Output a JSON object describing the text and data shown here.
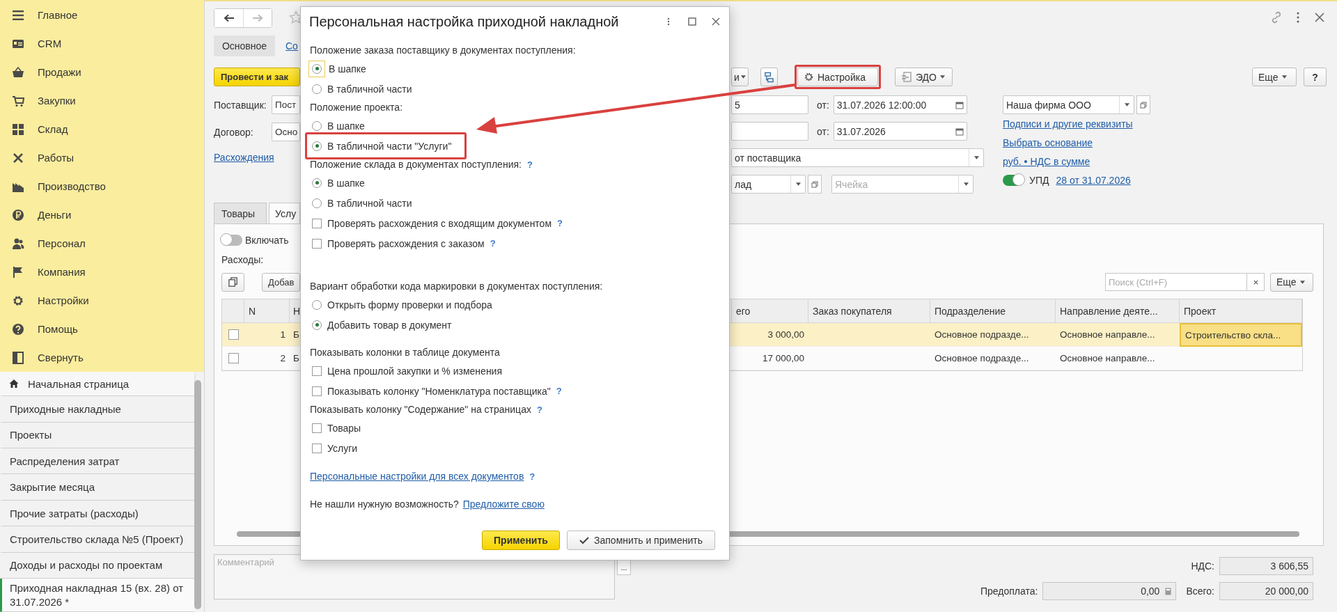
{
  "sidebar": {
    "menu": [
      {
        "label": "Главное"
      },
      {
        "label": "CRM"
      },
      {
        "label": "Продажи"
      },
      {
        "label": "Закупки"
      },
      {
        "label": "Склад"
      },
      {
        "label": "Работы"
      },
      {
        "label": "Производство"
      },
      {
        "label": "Деньги"
      },
      {
        "label": "Персонал"
      },
      {
        "label": "Компания"
      },
      {
        "label": "Настройки"
      },
      {
        "label": "Помощь"
      },
      {
        "label": "Свернуть"
      }
    ],
    "open_windows": [
      {
        "kind": "home",
        "label": "Начальная страница",
        "selected": false
      },
      {
        "kind": "window",
        "label": "Приходные накладные",
        "selected": false
      },
      {
        "kind": "window",
        "label": "Проекты",
        "selected": false
      },
      {
        "kind": "window",
        "label": "Распределения затрат",
        "selected": false
      },
      {
        "kind": "window",
        "label": "Закрытие месяца",
        "selected": false
      },
      {
        "kind": "window",
        "label": "Прочие затраты (расходы)",
        "selected": false
      },
      {
        "kind": "window",
        "label": "Строительство склада №5 (Проект)",
        "selected": false
      },
      {
        "kind": "window",
        "label": "Доходы и расходы по проектам",
        "selected": false
      },
      {
        "kind": "window",
        "label": "Приходная накладная 15 (вх. 28) от 31.07.2026 *",
        "selected": true
      }
    ]
  },
  "form": {
    "nav": [
      {
        "kind": "back",
        "disabled": false
      },
      {
        "kind": "forward",
        "disabled": true
      }
    ],
    "tabs": [
      {
        "label": "Основное",
        "selected": true
      },
      {
        "label": "Со",
        "selected": false
      }
    ],
    "toolbar": {
      "post_button": "Провести и зак",
      "buttons": [
        {
          "kind": "dropdown",
          "label": "и",
          "highlighted": false
        },
        {
          "kind": "icon",
          "highlighted": false
        },
        {
          "kind": "settings",
          "label": "Настройка",
          "highlighted": true
        },
        {
          "kind": "edo",
          "label": "ЭДО",
          "highlighted": false
        }
      ],
      "more": "Еще",
      "help": "?"
    },
    "header": {
      "supplier": {
        "label": "Поставщик:",
        "value": "Пост"
      },
      "contract": {
        "label": "Договор:",
        "value": "Осно"
      },
      "discrepancies_link": "Расхождения",
      "number": {
        "value": "5",
        "date_label": "от:",
        "date": "31.07.2026 12:00:00"
      },
      "incoming": {
        "date_label": "от:",
        "date": "31.07.2026"
      },
      "operation": "от поставщика",
      "warehouse": "лад",
      "cell_placeholder": "Ячейка",
      "organization": "Наша фирма ООО",
      "links": [
        "Подписи и другие реквизиты",
        "Выбрать основание",
        "руб. • НДС в сумме"
      ],
      "upd": {
        "on": true,
        "label": "УПД",
        "link": "28 от 31.07.2026"
      }
    }
  },
  "pages": {
    "tabs": [
      {
        "label": "Товары",
        "selected": false
      },
      {
        "label": "Услу",
        "selected": true
      }
    ],
    "include_toggle": {
      "on": false,
      "label": "Включать"
    },
    "expenses_label": "Расходы:",
    "add_button": "Добав",
    "search_placeholder": "Поиск (Ctrl+F)",
    "more": "Еще",
    "table": {
      "columns": [
        "N",
        "Н",
        "его",
        "Заказ покупателя",
        "Подразделение",
        "Направление деяте...",
        "Проект"
      ],
      "rows": [
        {
          "selected": true,
          "checked": false,
          "n": "1",
          "column_2": "Б",
          "total": "3 000,00",
          "department": "Основное подразде...",
          "direction": "Основное направле...",
          "project": "Строительство скла..."
        },
        {
          "selected": false,
          "checked": false,
          "n": "2",
          "column_2": "Б",
          "total": "17 000,00",
          "department": "Основное подразде...",
          "direction": "Основное направле..."
        }
      ]
    }
  },
  "totals": {
    "comment_placeholder": "Комментарий",
    "comment_button": "...",
    "vat_label": "НДС:",
    "vat": "3 606,55",
    "prepayment_label": "Предоплата:",
    "prepayment": "0,00",
    "total_label": "Всего:",
    "total": "20 000,00"
  },
  "dialog": {
    "title": "Персональная настройка приходной накладной",
    "sections": [
      {
        "heading": "Положение заказа поставщику в документах поступления:",
        "options": [
          {
            "kind": "radio",
            "label": "В шапке",
            "selected": true,
            "focused": true,
            "highlighted": false
          },
          {
            "kind": "radio",
            "label": "В табличной части",
            "selected": false,
            "focused": false,
            "highlighted": false
          }
        ]
      },
      {
        "heading": "Положение проекта:",
        "options": [
          {
            "kind": "radio",
            "label": "В шапке",
            "selected": false,
            "focused": false,
            "highlighted": false
          },
          {
            "kind": "radio",
            "label": "В табличной части \"Услуги\"",
            "selected": true,
            "focused": false,
            "highlighted": true
          }
        ]
      },
      {
        "heading": "Положение склада в документах поступления:",
        "help": "?",
        "options": [
          {
            "kind": "radio",
            "label": "В шапке",
            "selected": true,
            "focused": false,
            "highlighted": false
          },
          {
            "kind": "radio",
            "label": "В табличной части",
            "selected": false,
            "focused": false,
            "highlighted": false
          }
        ]
      },
      {
        "options": [
          {
            "kind": "checkbox",
            "label": "Проверять расхождения с входящим документом",
            "help": "?",
            "selected": false,
            "focused": false,
            "highlighted": false
          },
          {
            "kind": "checkbox",
            "label": "Проверять расхождения с заказом",
            "help": "?",
            "selected": false,
            "focused": false,
            "highlighted": false
          }
        ]
      },
      {
        "heading": "Вариант обработки кода маркировки в документах поступления:",
        "options": [
          {
            "kind": "radio",
            "label": "Открыть форму проверки и подбора",
            "selected": false,
            "focused": false,
            "highlighted": false
          },
          {
            "kind": "radio",
            "label": "Добавить товар в документ",
            "selected": true,
            "focused": false,
            "highlighted": false
          }
        ]
      },
      {
        "heading": "Показывать колонки в таблице документа",
        "options": [
          {
            "kind": "checkbox",
            "label": "Цена прошлой закупки и % изменения",
            "selected": false,
            "focused": false,
            "highlighted": false
          },
          {
            "kind": "checkbox",
            "label": "Показывать колонку \"Номенклатура поставщика\"",
            "help": "?",
            "selected": false,
            "focused": false,
            "highlighted": false
          }
        ]
      },
      {
        "heading": "Показывать колонку \"Содержание\" на страницах",
        "help": "?",
        "options": [
          {
            "kind": "checkbox",
            "label": "Товары",
            "selected": false,
            "focused": false,
            "highlighted": false
          },
          {
            "kind": "checkbox",
            "label": "Услуги",
            "selected": false,
            "focused": false,
            "highlighted": false
          }
        ]
      }
    ],
    "all_docs_link": "Персональные настройки для всех документов",
    "all_docs_help": "?",
    "note": "Не нашли нужную возможность?",
    "suggest_link": "Предложите свою",
    "apply_button": "Применить",
    "save_button": "Запомнить и применить"
  }
}
